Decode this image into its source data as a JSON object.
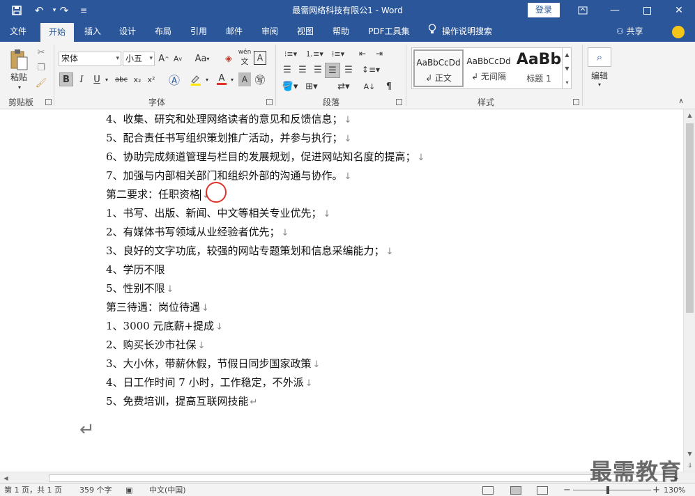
{
  "titlebar": {
    "doc_title": "最需网络科技有限公1  -  Word",
    "login_label": "登录",
    "save_icon": "save-icon",
    "undo_icon": "undo-icon",
    "redo_icon": "redo-icon",
    "customize_icon": "customize-qat-icon"
  },
  "tabs": [
    {
      "label": "文件"
    },
    {
      "label": "开始"
    },
    {
      "label": "插入"
    },
    {
      "label": "设计"
    },
    {
      "label": "布局"
    },
    {
      "label": "引用"
    },
    {
      "label": "邮件"
    },
    {
      "label": "审阅"
    },
    {
      "label": "视图"
    },
    {
      "label": "帮助"
    },
    {
      "label": "PDF工具集"
    }
  ],
  "tellme_label": "操作说明搜索",
  "share_label": "共享",
  "ribbon": {
    "clipboard": {
      "paste_label": "粘贴",
      "group_label": "剪贴板"
    },
    "font": {
      "font_name": "宋体",
      "font_size": "小五",
      "group_label": "字体",
      "bold": "B",
      "italic": "I",
      "underline": "U",
      "strike": "abc",
      "subscript": "x₂",
      "superscript": "x²",
      "grow": "A",
      "shrink": "A",
      "case": "Aa",
      "wen": "wén"
    },
    "paragraph": {
      "group_label": "段落"
    },
    "styles": {
      "group_label": "样式",
      "items": [
        {
          "sample": "AaBbCcDd",
          "name": "↲ 正文"
        },
        {
          "sample": "AaBbCcDd",
          "name": "↲ 无间隔"
        },
        {
          "sample": "AaBb",
          "name": "标题 1"
        }
      ]
    },
    "editing": {
      "label": "编辑"
    }
  },
  "document": {
    "lines": [
      {
        "text": "4、收集、研究和处理网络读者的意见和反馈信息；",
        "mark": "↓"
      },
      {
        "text": "5、配合责任书写组织策划推广活动，并参与执行；",
        "mark": "↓"
      },
      {
        "text": "6、协助完成频道管理与栏目的发展规划，促进网站知名度的提高；",
        "mark": "↓"
      },
      {
        "text": "7、加强与内部相关部门和组织外部的沟通与协作。",
        "mark": "↓"
      },
      {
        "text": "第二要求：任职资格",
        "mark": "↓"
      },
      {
        "text": "1、书写、出版、新闻、中文等相关专业优先；",
        "mark": "↓"
      },
      {
        "text": "2、有媒体书写领域从业经验者优先；",
        "mark": "↓"
      },
      {
        "text": "3、良好的文字功底，较强的网站专题策划和信息采编能力；",
        "mark": "↓"
      },
      {
        "text": "4、学历不限",
        "mark": ""
      },
      {
        "text": "5、性别不限",
        "mark": "↓"
      },
      {
        "text": "第三待遇：岗位待遇",
        "mark": "↓"
      },
      {
        "text": "1、3000 元底薪+提成",
        "mark": "↓"
      },
      {
        "text": "2、购买长沙市社保",
        "mark": "↓"
      },
      {
        "text": "3、大小休，带薪休假，节假日同步国家政策",
        "mark": "↓"
      },
      {
        "text": "4、日工作时间 7 小时，工作稳定，不外派",
        "mark": "↓"
      },
      {
        "text": "5、免费培训，提高互联网技能",
        "mark": "↵"
      }
    ],
    "end_mark": "↵"
  },
  "statusbar": {
    "page": "第 1 页，共 1 页",
    "words": "359 个字",
    "language": "中文(中国)",
    "zoom_minus": "−",
    "zoom_plus": "+",
    "zoom": "130%"
  },
  "watermark": "最需教育",
  "colors": {
    "accent": "#2b579a",
    "marker": "#e0322a"
  }
}
